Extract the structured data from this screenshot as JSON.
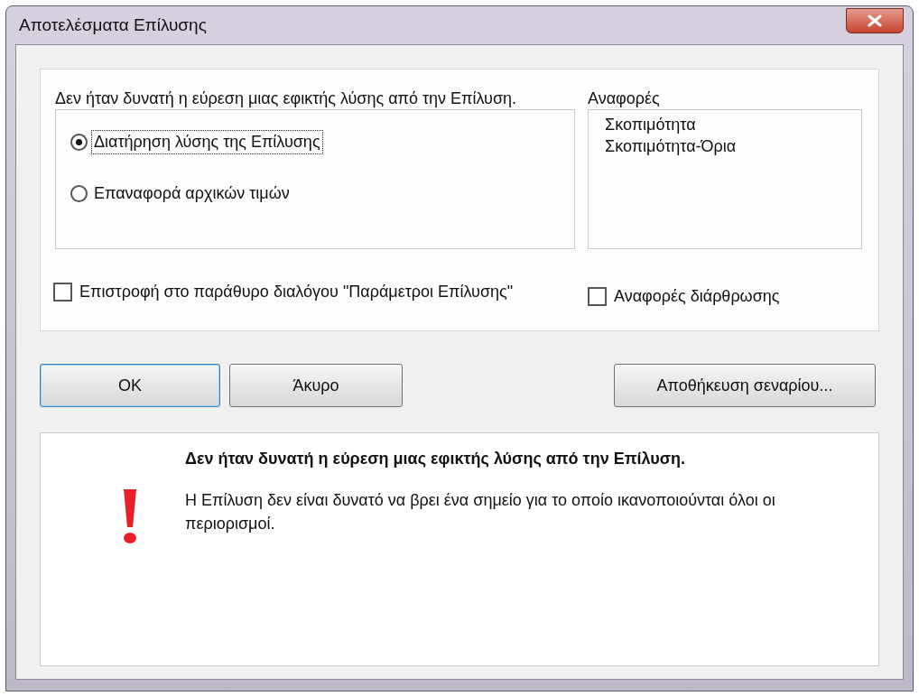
{
  "window": {
    "title": "Αποτελέσματα Επίλυσης"
  },
  "message": "Δεν ήταν δυνατή η εύρεση μιας εφικτής λύσης από την Επίλυση.",
  "options": [
    {
      "label": "Διατήρηση λύσης της Επίλυσης",
      "selected": true
    },
    {
      "label": "Επαναφορά αρχικών τιμών",
      "selected": false
    }
  ],
  "reports": {
    "label": "Αναφορές",
    "items": [
      "Σκοπιμότητα",
      "Σκοπιμότητα-Όρια"
    ]
  },
  "checkboxes": [
    {
      "label": "Επιστροφή στο παράθυρο διαλόγου \"Παράμετροι Επίλυσης\"",
      "checked": false
    },
    {
      "label": "Αναφορές διάρθρωσης",
      "checked": false
    }
  ],
  "buttons": [
    "OK",
    "Άκυρο",
    "Αποθήκευση σεναρίου..."
  ],
  "info": {
    "title": "Δεν ήταν δυνατή η εύρεση μιας εφικτής λύσης από την Επίλυση.",
    "body": "Η Επίλυση δεν είναι δυνατό να βρει ένα σημείο για το οποίο ικανοποιούνται όλοι οι περιορισμοί."
  }
}
